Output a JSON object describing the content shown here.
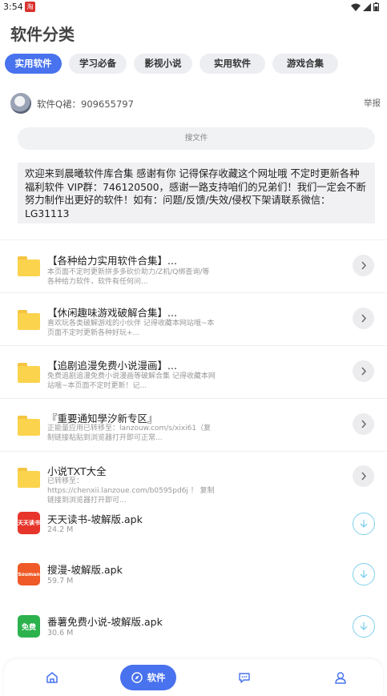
{
  "status_bar": {
    "time": "3:54",
    "app_icon_text": "淘"
  },
  "page_title": "软件分类",
  "tabs": [
    {
      "label": "实用软件",
      "active": true
    },
    {
      "label": "学习必备",
      "active": false
    },
    {
      "label": "影视小说",
      "active": false
    },
    {
      "label": "实用软件",
      "active": false
    },
    {
      "label": "游戏合集",
      "active": false
    }
  ],
  "qq_group": "软件Q裙：909655797",
  "report_label": "举报",
  "search": {
    "placeholder": "搜文件"
  },
  "notice": "欢迎来到晨曦软件库合集 感谢有你 记得保存收藏这个网址哦 不定时更新各种福利软件 VIP群：746120500，感谢一路支持咱们的兄弟们！我们一定会不断努力制作出更好的软件！如有：问题/反馈/失效/侵权下架请联系微信：LG31113",
  "folders": [
    {
      "title": "【各种给力实用软件合集】...",
      "desc": "本页面不定时更新拼多多砍价助力/Z机/Q绑查询/等各种给力软件，软件有任何问..."
    },
    {
      "title": "【休闲趣味游戏破解合集】...",
      "desc": "喜欢玩各类破解游戏的小伙伴 记得收藏本网站哦~本页面不定时更新各种好玩+..."
    },
    {
      "title": "【追剧追漫免费小说漫画】...",
      "desc": "免费追剧追漫免费小说漫画等破解合集 记得收藏本网站哦~本页面不定时更新！记..."
    },
    {
      "title": "『重要通知學汐新专区』",
      "desc": "正能量应用已转移至：lanzouw.com/s/xixi61（复制链接粘贴到浏览器打开即可正常..."
    },
    {
      "title": "小说TXT大全",
      "desc": "已转移至：https://chenxii.lanzoue.com/b0595pd6j ！ 复制链接到浏览器打开即可..."
    }
  ],
  "apks": [
    {
      "name": "天天读书-坡解版.apk",
      "size": "24.2 M",
      "icon_text": "天天读书",
      "icon_color": "#e8352b"
    },
    {
      "name": "搜漫-坡解版.apk",
      "size": "59.7 M",
      "icon_text": "Souman",
      "icon_color": "#f05a28"
    },
    {
      "name": "番薯免费小说-坡解版.apk",
      "size": "30.6 M",
      "icon_text": "免费",
      "icon_color": "#2bb24c"
    }
  ],
  "bottom_nav": {
    "home_icon": "home-icon",
    "software_label": "软件",
    "message_icon": "chat-icon",
    "profile_icon": "user-icon"
  },
  "colors": {
    "accent": "#4872ee",
    "folder": "#fbd34d",
    "download": "#7fd0ec"
  }
}
